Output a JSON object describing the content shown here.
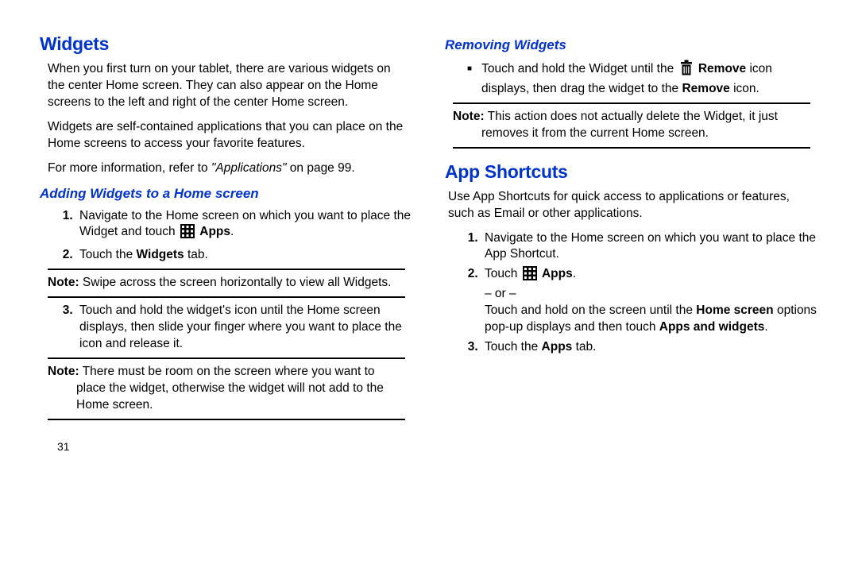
{
  "left": {
    "h1": "Widgets",
    "intro1": "When you first turn on your tablet, there are various widgets on the center Home screen. They can also appear on the Home screens to the left and right of the center Home screen.",
    "intro2": "Widgets are self-contained applications that you can place on the Home screens to access your favorite features.",
    "ref_pre": "For more information, refer to ",
    "ref_ital": "\"Applications\"",
    "ref_post": " on page 99.",
    "h2": "Adding Widgets to a Home screen",
    "step1": "Navigate to the Home screen on which you want to place the Widget and touch ",
    "step1_apps": "Apps",
    "step2_pre": "Touch the ",
    "step2_b": "Widgets",
    "step2_post": " tab.",
    "note1_label": "Note:",
    "note1_text": " Swipe across the screen horizontally to view all Widgets.",
    "step3": "Touch and hold the widget's icon until the Home screen displays, then slide your finger where you want to place the icon and release it.",
    "note2_label": "Note:",
    "note2_text": " There must be room on the screen where you want to place the widget, otherwise the widget will not add to the Home screen.",
    "pagenum": "31"
  },
  "right": {
    "h2a": "Removing Widgets",
    "bullet_pre": "Touch and hold the Widget until the ",
    "bullet_remove": "Remove",
    "bullet_mid": " icon displays, then drag the widget to the ",
    "bullet_remove2": "Remove",
    "bullet_post": " icon.",
    "noteA_label": "Note:",
    "noteA_text": " This action does not actually delete the Widget, it just removes it from the current Home screen.",
    "h1b": "App Shortcuts",
    "intro": "Use App Shortcuts for quick access to applications or features, such as Email or other applications.",
    "s1": "Navigate to the Home screen on which you want to place the App Shortcut.",
    "s2_pre": "Touch ",
    "s2_apps": "Apps",
    "s2_post": ".",
    "or": "– or –",
    "s2b_pre": "Touch and hold on the screen until the ",
    "s2b_hs": "Home screen",
    "s2b_mid": " options pop-up displays and then touch ",
    "s2b_aw": "Apps and widgets",
    "s2b_post": ".",
    "s3_pre": "Touch the ",
    "s3_b": "Apps",
    "s3_post": " tab."
  }
}
